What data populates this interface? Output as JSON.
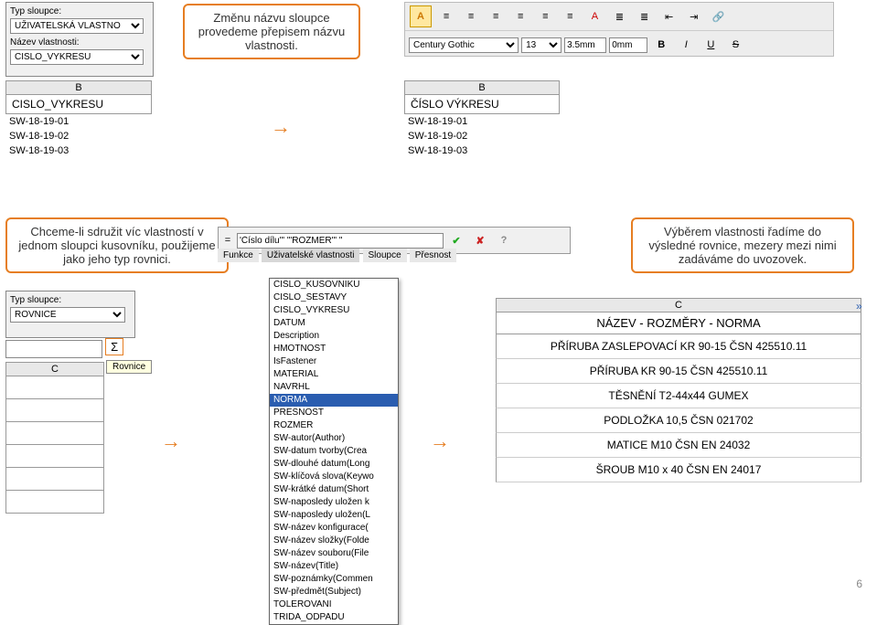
{
  "top_left_panel": {
    "label1": "Typ sloupce:",
    "field1": "UŽIVATELSKÁ VLASTNO",
    "label2": "Název vlastnosti:",
    "field2": "CISLO_VYKRESU"
  },
  "callout1": "Změnu názvu sloupce provedeme přepisem názvu vlastnosti.",
  "table_before": {
    "col": "B",
    "title": "CISLO_VYKRESU",
    "rows": [
      "SW-18-19-01",
      "SW-18-19-02",
      "SW-18-19-03"
    ]
  },
  "table_after": {
    "col": "B",
    "title": "ČÍSLO VÝKRESU",
    "rows": [
      "SW-18-19-01",
      "SW-18-19-02",
      "SW-18-19-03"
    ]
  },
  "toolbar": {
    "font": "Century Gothic",
    "size": "13",
    "gap": "3.5mm",
    "zero": "0mm",
    "letters": [
      "B",
      "I",
      "U",
      "S"
    ]
  },
  "callout2": "Chceme-li sdružit víc vlastností v jednom sloupci kusovníku, použijeme jako jeho typ rovnici.",
  "callout3": "Výběrem vlastnosti řadíme do výsledné rovnice, mezery mezi nimi zadáváme do uvozovek.",
  "mid_left_panel": {
    "label": "Typ sloupce:",
    "field": "ROVNICE",
    "sigma": "Σ",
    "col": "C",
    "tooltip": "Rovnice"
  },
  "formula_bar": {
    "eq": "=",
    "content": "'Číslo dílu'\" \"'ROZMER'\" \"",
    "tabs": [
      "Funkce",
      "Uživatelské vlastnosti",
      "Sloupce",
      "Přesnost"
    ]
  },
  "prop_list": [
    "CISLO_KUSOVNIKU",
    "CISLO_SESTAVY",
    "CISLO_VYKRESU",
    "DATUM",
    "Description",
    "HMOTNOST",
    "IsFastener",
    "MATERIAL",
    "NAVRHL",
    "NORMA",
    "PRESNOST",
    "ROZMER",
    "SW-autor(Author)",
    "SW-datum tvorby(Crea",
    "SW-dlouhé datum(Long",
    "SW-klíčová slova(Keywo",
    "SW-krátké datum(Short",
    "SW-naposledy uložen k",
    "SW-naposledy uložen(L",
    "SW-název konfigurace(",
    "SW-název složky(Folde",
    "SW-název souboru(File",
    "SW-název(Title)",
    "SW-poznámky(Commen",
    "SW-předmět(Subject)",
    "TOLEROVANI",
    "TRIDA_ODPADU"
  ],
  "prop_selected": "NORMA",
  "result_table": {
    "col": "C",
    "title": "NÁZEV - ROZMĚRY - NORMA",
    "rows": [
      "PŘÍRUBA ZASLEPOVACÍ KR 90-15 ČSN 425510.11",
      "PŘÍRUBA KR 90-15 ČSN 425510.11",
      "TĚSNĚNÍ T2-44x44 GUMEX",
      "PODLOŽKA 10,5 ČSN 021702",
      "MATICE M10 ČSN EN 24032",
      "ŠROUB M10 x 40 ČSN EN 24017"
    ]
  },
  "page_number": "6"
}
